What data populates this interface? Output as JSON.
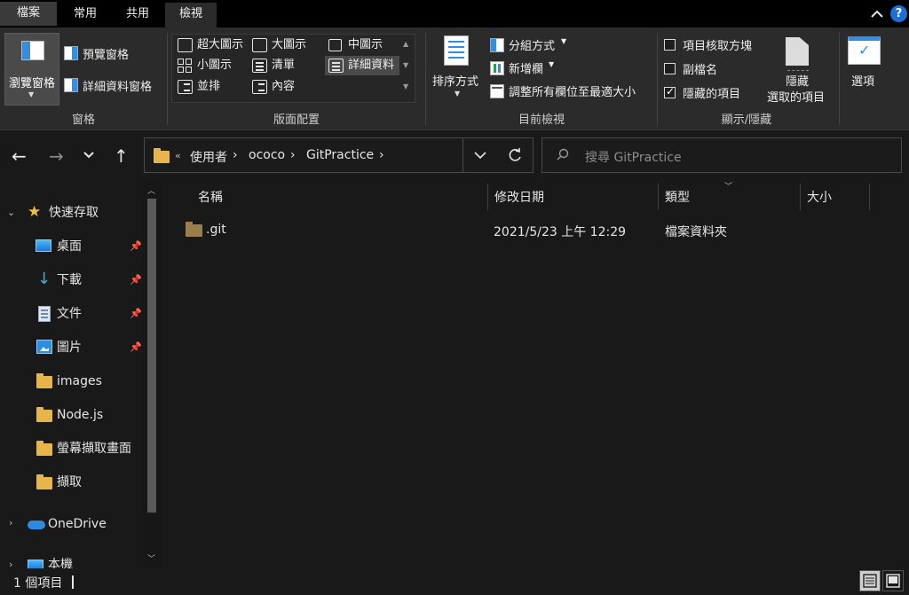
{
  "tabs": {
    "file": "檔案",
    "home": "常用",
    "share": "共用",
    "view": "檢視"
  },
  "help_label": "?",
  "ribbon": {
    "panes": {
      "navigation_pane": "瀏覽窗格",
      "preview_pane": "預覽窗格",
      "details_pane": "詳細資料窗格",
      "group_label": "窗格"
    },
    "layout": {
      "items": [
        "超大圖示",
        "大圖示",
        "中圖示",
        "小圖示",
        "清單",
        "詳細資料",
        "並排",
        "內容"
      ],
      "selected": "詳細資料",
      "group_label": "版面配置"
    },
    "current_view": {
      "sort_by": "排序方式",
      "group_by": "分組方式",
      "add_columns": "新增欄",
      "size_all_columns": "調整所有欄位至最適大小",
      "group_label": "目前檢視"
    },
    "show_hide": {
      "item_checkboxes": "項目核取方塊",
      "file_name_extensions": "副檔名",
      "hidden_items": "隱藏的項目",
      "item_checkboxes_checked": false,
      "file_name_extensions_checked": false,
      "hidden_items_checked": true,
      "hide_selected_line1": "隱藏",
      "hide_selected_line2": "選取的項目",
      "group_label": "顯示/隱藏"
    },
    "options": "選項"
  },
  "address": {
    "overflow": "«",
    "crumbs": [
      "使用者",
      "ococo",
      "GitPractice"
    ],
    "search_placeholder": "搜尋 GitPractice"
  },
  "nav": {
    "quick_access": "快速存取",
    "items": [
      "桌面",
      "下載",
      "文件",
      "圖片",
      "images",
      "Node.js",
      "螢幕擷取畫面",
      "擷取"
    ],
    "onedrive": "OneDrive",
    "this_pc": "本機"
  },
  "columns": {
    "name": "名稱",
    "date_modified": "修改日期",
    "type": "類型",
    "size": "大小"
  },
  "files": [
    {
      "name": ".git",
      "date_modified": "2021/5/23 上午 12:29",
      "type": "檔案資料夾",
      "size": ""
    }
  ],
  "status": {
    "item_count": "1 個項目"
  },
  "colors": {
    "accent": "#2f8ee6",
    "folder": "#e8b54a",
    "background": "#191919"
  }
}
